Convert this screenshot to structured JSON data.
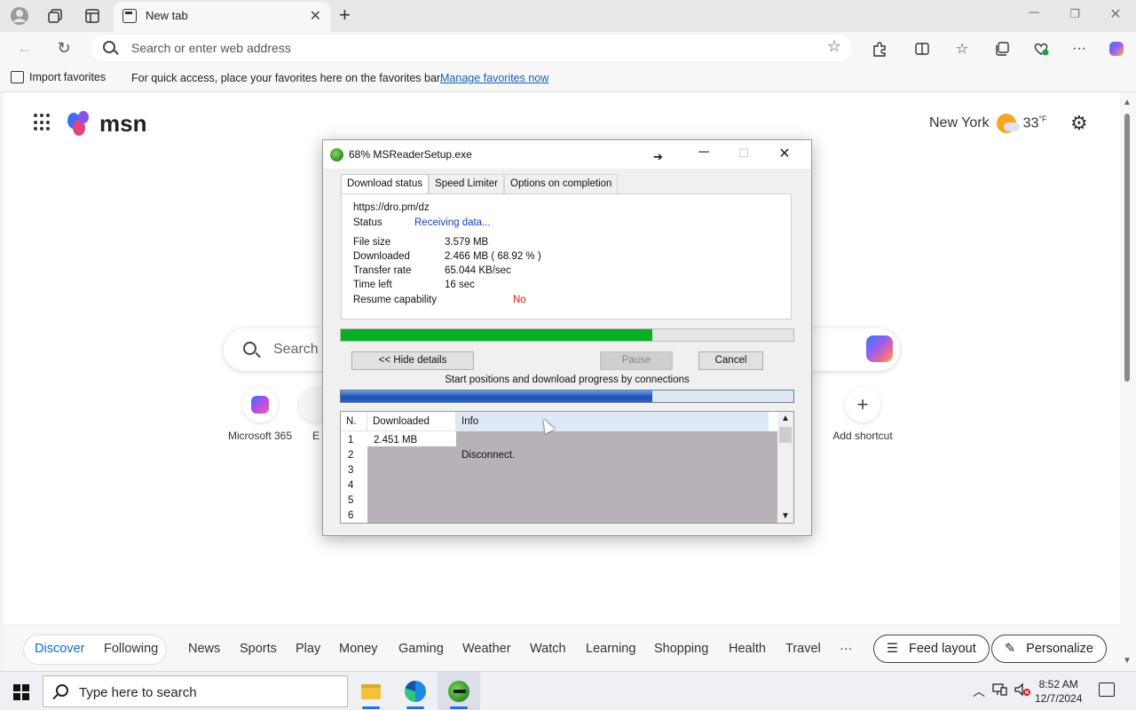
{
  "browser": {
    "tab_title": "New tab",
    "address_placeholder": "Search or enter web address",
    "favbar": {
      "import_label": "Import favorites",
      "message": "For quick access, place your favorites here on the favorites bar.",
      "manage_link": "Manage favorites now"
    }
  },
  "msn": {
    "logo_text": "msn",
    "weather": {
      "city": "New York",
      "temp": "33",
      "unit": "°F"
    },
    "search_placeholder": "Search t",
    "shortcuts": [
      {
        "label": "Microsoft 365"
      },
      {
        "label": "E"
      },
      {
        "label": "Add shortcut"
      }
    ],
    "discover": {
      "items": [
        "Discover",
        "Following",
        "News",
        "Sports",
        "Play",
        "Money",
        "Gaming",
        "Weather",
        "Watch",
        "Learning",
        "Shopping",
        "Health",
        "Travel",
        "···"
      ],
      "active": "Discover",
      "feed_layout": "Feed layout",
      "personalize": "Personalize"
    }
  },
  "dialog": {
    "title": "68% MSReaderSetup.exe",
    "tabs": [
      "Download status",
      "Speed Limiter",
      "Options on completion"
    ],
    "active_tab": "Download status",
    "url": "https://dro.pm/dz",
    "status_label": "Status",
    "status_value": "Receiving data...",
    "rows": [
      {
        "label": "File size",
        "value": "3.579  MB"
      },
      {
        "label": "Downloaded",
        "value": "2.466  MB  ( 68.92 % )"
      },
      {
        "label": "Transfer rate",
        "value": "65.044  KB/sec"
      },
      {
        "label": "Time left",
        "value": "16 sec"
      }
    ],
    "resume_label": "Resume capability",
    "resume_value": "No",
    "progress_fraction": 0.6892,
    "connection_progress_fraction": 0.688,
    "buttons": {
      "hide_details": "<< Hide details",
      "pause": "Pause",
      "cancel": "Cancel"
    },
    "connections_caption": "Start positions and download progress by connections",
    "table": {
      "headers": [
        "N.",
        "Downloaded",
        "Info"
      ],
      "rows": [
        {
          "n": "1",
          "downloaded": "2.451  MB",
          "info": ""
        },
        {
          "n": "2",
          "downloaded": "",
          "info": "Disconnect."
        },
        {
          "n": "3",
          "downloaded": "",
          "info": ""
        },
        {
          "n": "4",
          "downloaded": "",
          "info": ""
        },
        {
          "n": "5",
          "downloaded": "",
          "info": ""
        },
        {
          "n": "6",
          "downloaded": "",
          "info": ""
        }
      ]
    }
  },
  "taskbar": {
    "search_placeholder": "Type here to search",
    "time": "8:52 AM",
    "date": "12/7/2024"
  },
  "colors": {
    "progress_green": "#06b025",
    "connection_blue": "#1e4fb0",
    "link_blue": "#1a5fb4",
    "accent": "#0f6cbd"
  }
}
